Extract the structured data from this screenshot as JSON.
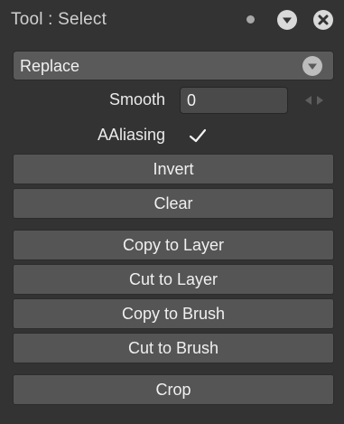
{
  "window": {
    "title": "Tool : Select"
  },
  "mode_dropdown": {
    "selected": "Replace"
  },
  "smooth": {
    "label": "Smooth",
    "value": "0"
  },
  "antialiasing": {
    "label": "AAliasing",
    "checked": true
  },
  "buttons": {
    "invert": "Invert",
    "clear": "Clear",
    "copy_to_layer": "Copy to Layer",
    "cut_to_layer": "Cut to Layer",
    "copy_to_brush": "Copy to Brush",
    "cut_to_brush": "Cut to Brush",
    "crop": "Crop"
  },
  "icons": {
    "status": "dot-icon",
    "menu": "chevron-down-icon",
    "close": "close-icon",
    "dropdown": "chevron-down-icon",
    "stepper": "left-right-arrows-icon",
    "checkbox": "checkmark-icon"
  },
  "colors": {
    "panel_bg": "#333333",
    "button_bg": "#555555",
    "field_bg": "#4a4a4a",
    "text": "#f0f0f0"
  }
}
